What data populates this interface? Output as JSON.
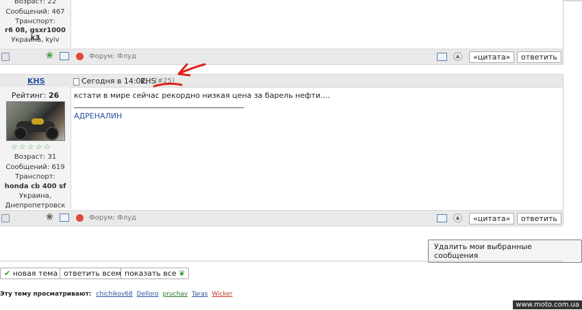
{
  "post1": {
    "age": "Возраст: 22",
    "messages": "Сообщений: 467",
    "transport_label": "Транспорт:",
    "transport": "r6 08, gsxr1000 k3",
    "location": "Украина, kyiv",
    "forum": "Форум: Флуд",
    "quote_label": "«цитата»",
    "reply_label": "ответить"
  },
  "post2": {
    "username": "KHS",
    "rating_label": "Рейтинг:",
    "rating_value": "26",
    "age": "Возраст: 31",
    "messages": "Сообщений: 619",
    "transport_label": "Транспорт:",
    "transport": "honda cb 400 sf",
    "location_line1": "Украина,",
    "location_line2": "Днепропетровск",
    "header_date": "Сегодня в 14:02, ",
    "header_author": "KHS",
    "post_number": "(#25)",
    "body": "кстати в мире сейчас рекордно низкая цена за барель нефти....",
    "signature": "АДРЕНАЛИН",
    "forum": "Форум: Флуд",
    "quote_label": "«цитата»",
    "reply_label": "ответить",
    "stars_filled": 5
  },
  "delete_button": "Удалить мои выбранные сообщения",
  "actions": {
    "new_topic": "новая тема",
    "reply_all": "ответить всем",
    "show_all": "показать все"
  },
  "viewers": {
    "label": "Эту тему просматривают:",
    "users": [
      "chichikov68",
      "Delloro",
      "pruchav",
      "Taras",
      "Wicker"
    ]
  },
  "watermark": "www.moto.com.ua",
  "colors": {
    "bar_bg": "#e9e9e9",
    "sidebar_bg": "#f3f3f3",
    "link": "#2a4f9e",
    "annotation_red": "#e0201a",
    "star_green": "#47a24a"
  }
}
